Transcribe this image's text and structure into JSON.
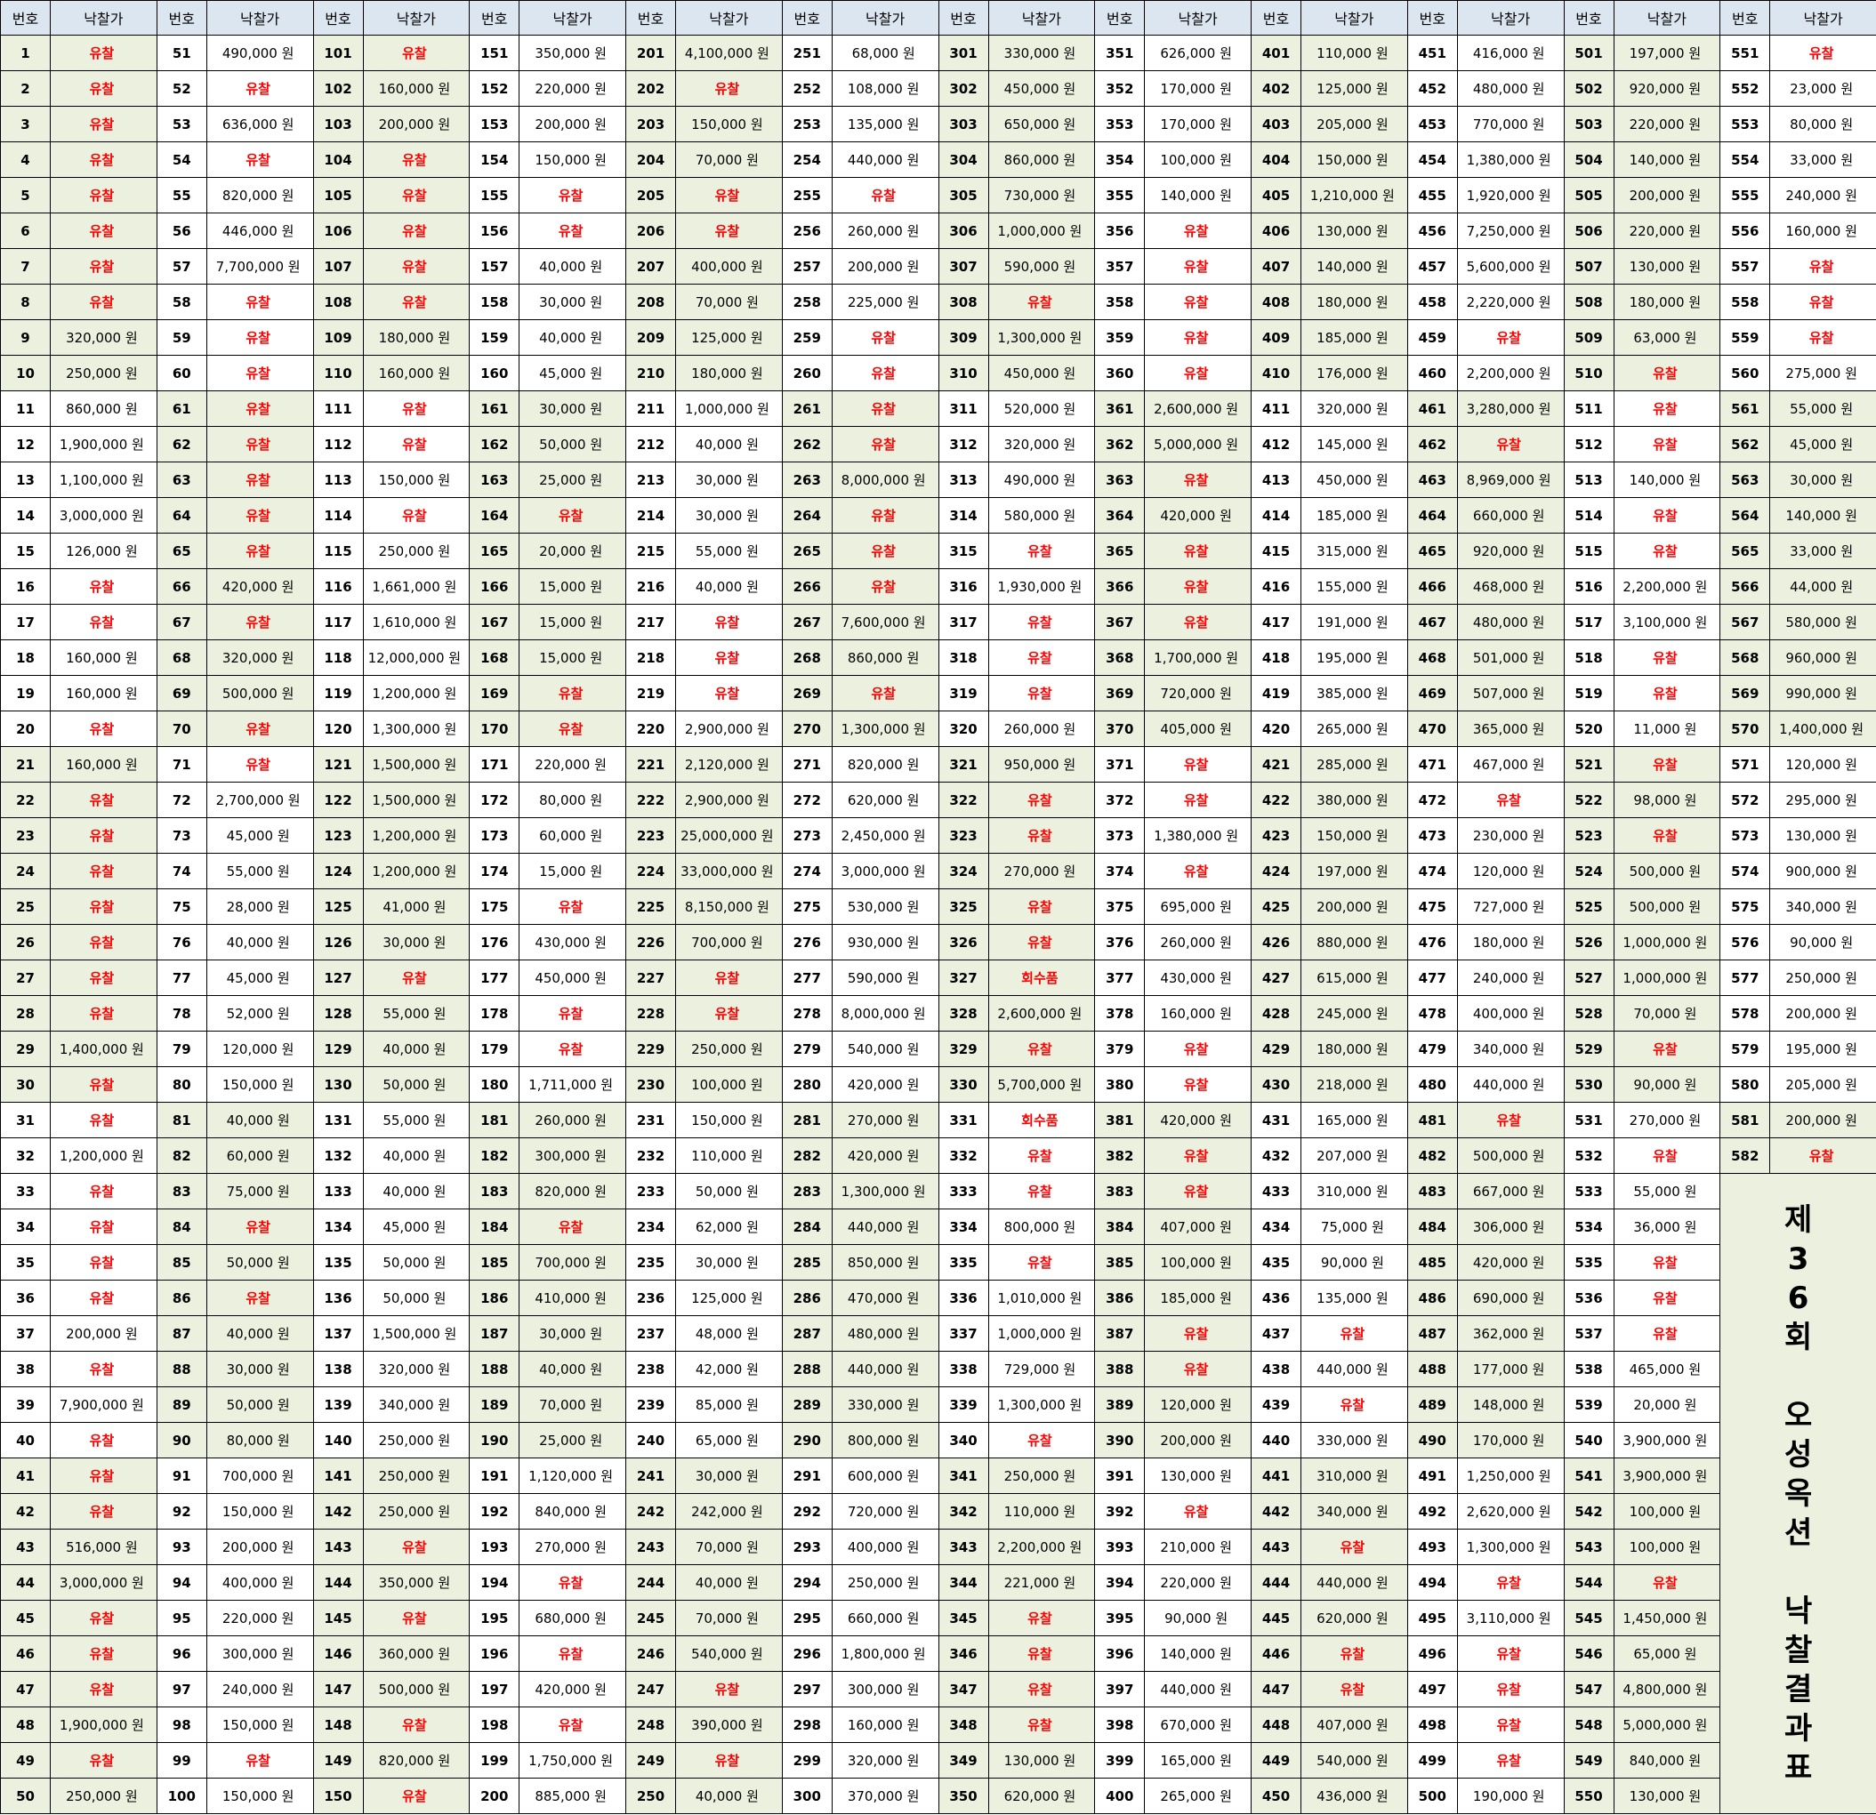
{
  "header": {
    "num_label": "번호",
    "price_label": "낙찰가"
  },
  "fail_text": "유찰",
  "recall_text": "회수품",
  "colors": {
    "header_bg": "#dce6f1",
    "stripe_bg": "#ebf1de",
    "fail_red": "#ff0000"
  },
  "side_title": [
    "제",
    "3",
    "6",
    "회",
    "",
    "오",
    "성",
    "옥",
    "션",
    "",
    "낙",
    "찰",
    "결",
    "과",
    "표"
  ],
  "columns": [
    [
      "F",
      "F",
      "F",
      "F",
      "F",
      "F",
      "F",
      "F",
      "320,000 원",
      "250,000 원",
      "860,000 원",
      "1,900,000 원",
      "1,100,000 원",
      "3,000,000 원",
      "126,000 원",
      "F",
      "F",
      "160,000 원",
      "160,000 원",
      "F",
      "160,000 원",
      "F",
      "F",
      "F",
      "F",
      "F",
      "F",
      "F",
      "1,400,000 원",
      "F",
      "F",
      "1,200,000 원",
      "F",
      "F",
      "F",
      "F",
      "200,000 원",
      "F",
      "7,900,000 원",
      "F",
      "F",
      "F",
      "516,000 원",
      "3,000,000 원",
      "F",
      "F",
      "F",
      "1,900,000 원",
      "F",
      "250,000 원"
    ],
    [
      "490,000 원",
      "F",
      "636,000 원",
      "F",
      "820,000 원",
      "446,000 원",
      "7,700,000 원",
      "F",
      "F",
      "F",
      "F",
      "F",
      "F",
      "F",
      "F",
      "420,000 원",
      "F",
      "320,000 원",
      "500,000 원",
      "F",
      "F",
      "2,700,000 원",
      "45,000 원",
      "55,000 원",
      "28,000 원",
      "40,000 원",
      "45,000 원",
      "52,000 원",
      "120,000 원",
      "150,000 원",
      "40,000 원",
      "60,000 원",
      "75,000 원",
      "F",
      "50,000 원",
      "F",
      "40,000 원",
      "30,000 원",
      "50,000 원",
      "80,000 원",
      "700,000 원",
      "150,000 원",
      "200,000 원",
      "400,000 원",
      "220,000 원",
      "300,000 원",
      "240,000 원",
      "150,000 원",
      "F",
      "150,000 원"
    ],
    [
      "F",
      "160,000 원",
      "200,000 원",
      "F",
      "F",
      "F",
      "F",
      "F",
      "180,000 원",
      "160,000 원",
      "F",
      "F",
      "150,000 원",
      "F",
      "250,000 원",
      "1,661,000 원",
      "1,610,000 원",
      "12,000,000 원",
      "1,200,000 원",
      "1,300,000 원",
      "1,500,000 원",
      "1,500,000 원",
      "1,200,000 원",
      "1,200,000 원",
      "41,000 원",
      "30,000 원",
      "F",
      "55,000 원",
      "40,000 원",
      "50,000 원",
      "55,000 원",
      "40,000 원",
      "40,000 원",
      "45,000 원",
      "50,000 원",
      "50,000 원",
      "1,500,000 원",
      "320,000 원",
      "340,000 원",
      "250,000 원",
      "250,000 원",
      "250,000 원",
      "F",
      "350,000 원",
      "F",
      "360,000 원",
      "500,000 원",
      "F",
      "820,000 원",
      "F"
    ],
    [
      "350,000 원",
      "220,000 원",
      "200,000 원",
      "150,000 원",
      "F",
      "F",
      "40,000 원",
      "30,000 원",
      "40,000 원",
      "45,000 원",
      "30,000 원",
      "50,000 원",
      "25,000 원",
      "F",
      "20,000 원",
      "15,000 원",
      "15,000 원",
      "15,000 원",
      "F",
      "F",
      "220,000 원",
      "80,000 원",
      "60,000 원",
      "15,000 원",
      "F",
      "430,000 원",
      "450,000 원",
      "F",
      "F",
      "1,711,000 원",
      "260,000 원",
      "300,000 원",
      "820,000 원",
      "F",
      "700,000 원",
      "410,000 원",
      "30,000 원",
      "40,000 원",
      "70,000 원",
      "25,000 원",
      "1,120,000 원",
      "840,000 원",
      "270,000 원",
      "F",
      "680,000 원",
      "F",
      "420,000 원",
      "F",
      "1,750,000 원",
      "885,000 원"
    ],
    [
      "4,100,000 원",
      "F",
      "150,000 원",
      "70,000 원",
      "F",
      "F",
      "400,000 원",
      "70,000 원",
      "125,000 원",
      "180,000 원",
      "1,000,000 원",
      "40,000 원",
      "30,000 원",
      "30,000 원",
      "55,000 원",
      "40,000 원",
      "F",
      "F",
      "F",
      "2,900,000 원",
      "2,120,000 원",
      "2,900,000 원",
      "25,000,000 원",
      "33,000,000 원",
      "8,150,000 원",
      "700,000 원",
      "F",
      "F",
      "250,000 원",
      "100,000 원",
      "150,000 원",
      "110,000 원",
      "50,000 원",
      "62,000 원",
      "30,000 원",
      "125,000 원",
      "48,000 원",
      "42,000 원",
      "85,000 원",
      "65,000 원",
      "30,000 원",
      "242,000 원",
      "70,000 원",
      "40,000 원",
      "70,000 원",
      "540,000 원",
      "F",
      "390,000 원",
      "F",
      "40,000 원"
    ],
    [
      "68,000 원",
      "108,000 원",
      "135,000 원",
      "440,000 원",
      "F",
      "260,000 원",
      "200,000 원",
      "225,000 원",
      "F",
      "F",
      "F",
      "F",
      "8,000,000 원",
      "F",
      "F",
      "F",
      "7,600,000 원",
      "860,000 원",
      "F",
      "1,300,000 원",
      "820,000 원",
      "620,000 원",
      "2,450,000 원",
      "3,000,000 원",
      "530,000 원",
      "930,000 원",
      "590,000 원",
      "8,000,000 원",
      "540,000 원",
      "420,000 원",
      "270,000 원",
      "420,000 원",
      "1,300,000 원",
      "440,000 원",
      "850,000 원",
      "470,000 원",
      "480,000 원",
      "440,000 원",
      "330,000 원",
      "800,000 원",
      "600,000 원",
      "720,000 원",
      "400,000 원",
      "250,000 원",
      "660,000 원",
      "1,800,000 원",
      "300,000 원",
      "160,000 원",
      "320,000 원",
      "370,000 원"
    ],
    [
      "330,000 원",
      "450,000 원",
      "650,000 원",
      "860,000 원",
      "730,000 원",
      "1,000,000 원",
      "590,000 원",
      "F",
      "1,300,000 원",
      "450,000 원",
      "520,000 원",
      "320,000 원",
      "490,000 원",
      "580,000 원",
      "F",
      "1,930,000 원",
      "F",
      "F",
      "F",
      "260,000 원",
      "950,000 원",
      "F",
      "F",
      "270,000 원",
      "F",
      "F",
      "R",
      "2,600,000 원",
      "F",
      "5,700,000 원",
      "R",
      "F",
      "F",
      "800,000 원",
      "F",
      "1,010,000 원",
      "1,000,000 원",
      "729,000 원",
      "1,300,000 원",
      "F",
      "250,000 원",
      "110,000 원",
      "2,200,000 원",
      "221,000 원",
      "F",
      "F",
      "F",
      "F",
      "130,000 원",
      "620,000 원"
    ],
    [
      "626,000 원",
      "170,000 원",
      "170,000 원",
      "100,000 원",
      "140,000 원",
      "F",
      "F",
      "F",
      "F",
      "F",
      "2,600,000 원",
      "5,000,000 원",
      "F",
      "420,000 원",
      "F",
      "F",
      "F",
      "1,700,000 원",
      "720,000 원",
      "405,000 원",
      "F",
      "F",
      "1,380,000 원",
      "F",
      "695,000 원",
      "260,000 원",
      "430,000 원",
      "160,000 원",
      "F",
      "F",
      "420,000 원",
      "F",
      "F",
      "407,000 원",
      "100,000 원",
      "185,000 원",
      "F",
      "F",
      "120,000 원",
      "200,000 원",
      "130,000 원",
      "F",
      "210,000 원",
      "220,000 원",
      "90,000 원",
      "140,000 원",
      "440,000 원",
      "670,000 원",
      "165,000 원",
      "265,000 원"
    ],
    [
      "110,000 원",
      "125,000 원",
      "205,000 원",
      "150,000 원",
      "1,210,000 원",
      "130,000 원",
      "140,000 원",
      "180,000 원",
      "185,000 원",
      "176,000 원",
      "320,000 원",
      "145,000 원",
      "450,000 원",
      "185,000 원",
      "315,000 원",
      "155,000 원",
      "191,000 원",
      "195,000 원",
      "385,000 원",
      "265,000 원",
      "285,000 원",
      "380,000 원",
      "150,000 원",
      "197,000 원",
      "200,000 원",
      "880,000 원",
      "615,000 원",
      "245,000 원",
      "180,000 원",
      "218,000 원",
      "165,000 원",
      "207,000 원",
      "310,000 원",
      "75,000 원",
      "90,000 원",
      "135,000 원",
      "F",
      "440,000 원",
      "F",
      "330,000 원",
      "310,000 원",
      "340,000 원",
      "F",
      "440,000 원",
      "620,000 원",
      "F",
      "F",
      "407,000 원",
      "540,000 원",
      "436,000 원"
    ],
    [
      "416,000 원",
      "480,000 원",
      "770,000 원",
      "1,380,000 원",
      "1,920,000 원",
      "7,250,000 원",
      "5,600,000 원",
      "2,220,000 원",
      "F",
      "2,200,000 원",
      "3,280,000 원",
      "F",
      "8,969,000 원",
      "660,000 원",
      "920,000 원",
      "468,000 원",
      "480,000 원",
      "501,000 원",
      "507,000 원",
      "365,000 원",
      "467,000 원",
      "F",
      "230,000 원",
      "120,000 원",
      "727,000 원",
      "180,000 원",
      "240,000 원",
      "400,000 원",
      "340,000 원",
      "440,000 원",
      "F",
      "500,000 원",
      "667,000 원",
      "306,000 원",
      "420,000 원",
      "690,000 원",
      "362,000 원",
      "177,000 원",
      "148,000 원",
      "170,000 원",
      "1,250,000 원",
      "2,620,000 원",
      "1,300,000 원",
      "F",
      "3,110,000 원",
      "F",
      "F",
      "F",
      "F",
      "190,000 원"
    ],
    [
      "197,000 원",
      "920,000 원",
      "220,000 원",
      "140,000 원",
      "200,000 원",
      "220,000 원",
      "130,000 원",
      "180,000 원",
      "63,000 원",
      "F",
      "F",
      "F",
      "140,000 원",
      "F",
      "F",
      "2,200,000 원",
      "3,100,000 원",
      "F",
      "F",
      "11,000 원",
      "F",
      "98,000 원",
      "F",
      "500,000 원",
      "500,000 원",
      "1,000,000 원",
      "1,000,000 원",
      "70,000 원",
      "F",
      "90,000 원",
      "270,000 원",
      "F",
      "55,000 원",
      "36,000 원",
      "F",
      "F",
      "F",
      "465,000 원",
      "20,000 원",
      "3,900,000 원",
      "3,900,000 원",
      "100,000 원",
      "100,000 원",
      "F",
      "1,450,000 원",
      "65,000 원",
      "4,800,000 원",
      "5,000,000 원",
      "840,000 원",
      "130,000 원"
    ],
    [
      "F",
      "23,000 원",
      "80,000 원",
      "33,000 원",
      "240,000 원",
      "160,000 원",
      "F",
      "F",
      "F",
      "275,000 원",
      "55,000 원",
      "45,000 원",
      "30,000 원",
      "140,000 원",
      "33,000 원",
      "44,000 원",
      "580,000 원",
      "960,000 원",
      "990,000 원",
      "1,400,000 원",
      "120,000 원",
      "295,000 원",
      "130,000 원",
      "900,000 원",
      "340,000 원",
      "90,000 원",
      "250,000 원",
      "200,000 원",
      "195,000 원",
      "205,000 원",
      "200,000 원",
      "F"
    ]
  ]
}
